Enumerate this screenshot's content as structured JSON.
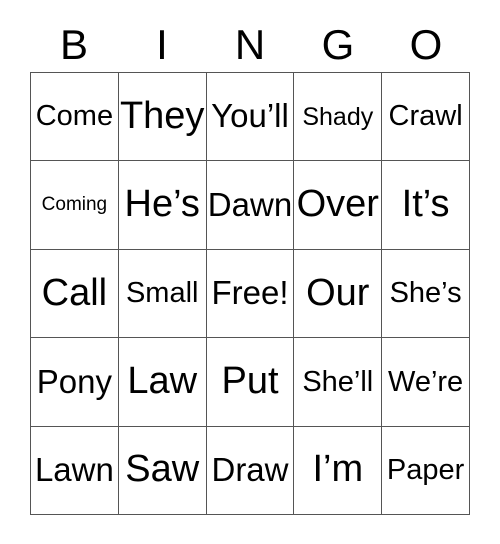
{
  "card": {
    "title": "BINGO",
    "background_color": "#ffffff",
    "text_color": "#000000",
    "border_color": "#555555",
    "columns": 5,
    "rows": 5
  },
  "header": {
    "letters": [
      {
        "label": "B"
      },
      {
        "label": "I"
      },
      {
        "label": "N"
      },
      {
        "label": "G"
      },
      {
        "label": "O"
      }
    ]
  },
  "grid": {
    "rows": [
      {
        "cells": [
          {
            "label": "Come",
            "size": "sz-m"
          },
          {
            "label": "They",
            "size": "sz-xl"
          },
          {
            "label": "You’ll",
            "size": "sz-l"
          },
          {
            "label": "Shady",
            "size": "sz-s"
          },
          {
            "label": "Crawl",
            "size": "sz-m"
          }
        ]
      },
      {
        "cells": [
          {
            "label": "Coming",
            "size": "sz-xs"
          },
          {
            "label": "He’s",
            "size": "sz-xl"
          },
          {
            "label": "Dawn",
            "size": "sz-l"
          },
          {
            "label": "Over",
            "size": "sz-xl"
          },
          {
            "label": "It’s",
            "size": "sz-xl"
          }
        ]
      },
      {
        "cells": [
          {
            "label": "Call",
            "size": "sz-xl"
          },
          {
            "label": "Small",
            "size": "sz-m"
          },
          {
            "label": "Free!",
            "size": "sz-l"
          },
          {
            "label": "Our",
            "size": "sz-xl"
          },
          {
            "label": "She’s",
            "size": "sz-m"
          }
        ]
      },
      {
        "cells": [
          {
            "label": "Pony",
            "size": "sz-l"
          },
          {
            "label": "Law",
            "size": "sz-xl"
          },
          {
            "label": "Put",
            "size": "sz-xl"
          },
          {
            "label": "She’ll",
            "size": "sz-m"
          },
          {
            "label": "We’re",
            "size": "sz-m"
          }
        ]
      },
      {
        "cells": [
          {
            "label": "Lawn",
            "size": "sz-l"
          },
          {
            "label": "Saw",
            "size": "sz-xl"
          },
          {
            "label": "Draw",
            "size": "sz-l"
          },
          {
            "label": "I’m",
            "size": "sz-xl"
          },
          {
            "label": "Paper",
            "size": "sz-m"
          }
        ]
      }
    ]
  }
}
